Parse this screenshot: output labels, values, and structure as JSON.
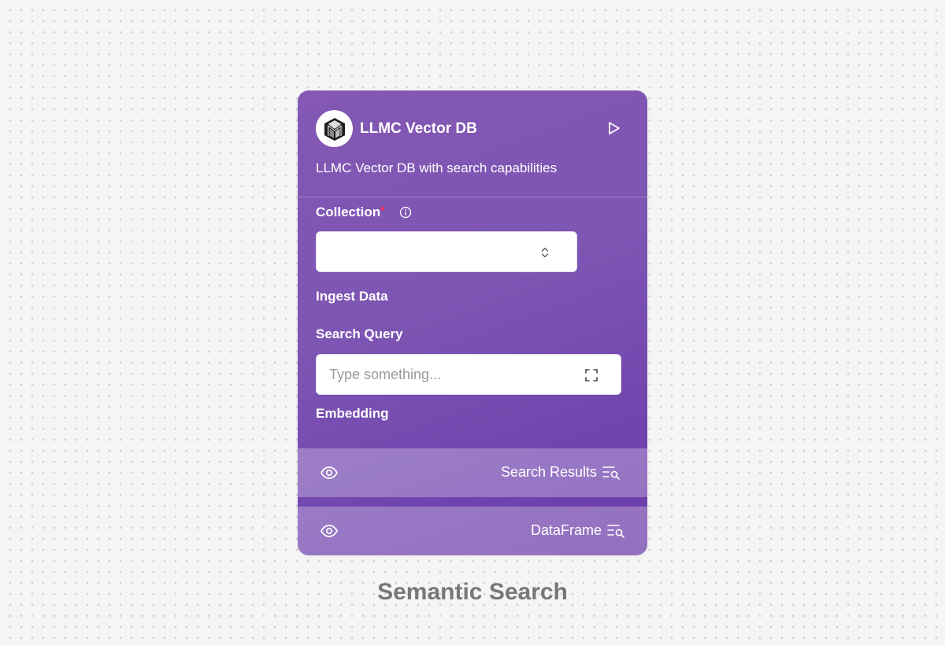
{
  "node": {
    "title": "LLMC Vector DB",
    "description": "LLMC Vector DB with search capabilities",
    "logo_icon": "llmc-cube-logo-icon",
    "run_icon": "play-icon"
  },
  "fields": {
    "collection": {
      "label": "Collection",
      "required_marker": "*",
      "info_icon": "info-icon",
      "value": "",
      "select_icon": "chevron-up-down-icon"
    },
    "ingest_data": {
      "label": "Ingest Data"
    },
    "search_query": {
      "label": "Search Query",
      "value": "",
      "placeholder": "Type something...",
      "expand_icon": "expand-icon"
    },
    "embedding": {
      "label": "Embedding"
    }
  },
  "outputs": [
    {
      "label": "Search Results",
      "eye_icon": "eye-icon",
      "type_icon": "list-search-icon"
    },
    {
      "label": "DataFrame",
      "eye_icon": "eye-icon",
      "type_icon": "list-search-icon"
    }
  ],
  "caption": "Semantic Search",
  "colors": {
    "node_gradient_start": "#8458b4",
    "node_gradient_end": "#6a3aa8",
    "required": "#ff2d4d",
    "caption": "#777777"
  }
}
